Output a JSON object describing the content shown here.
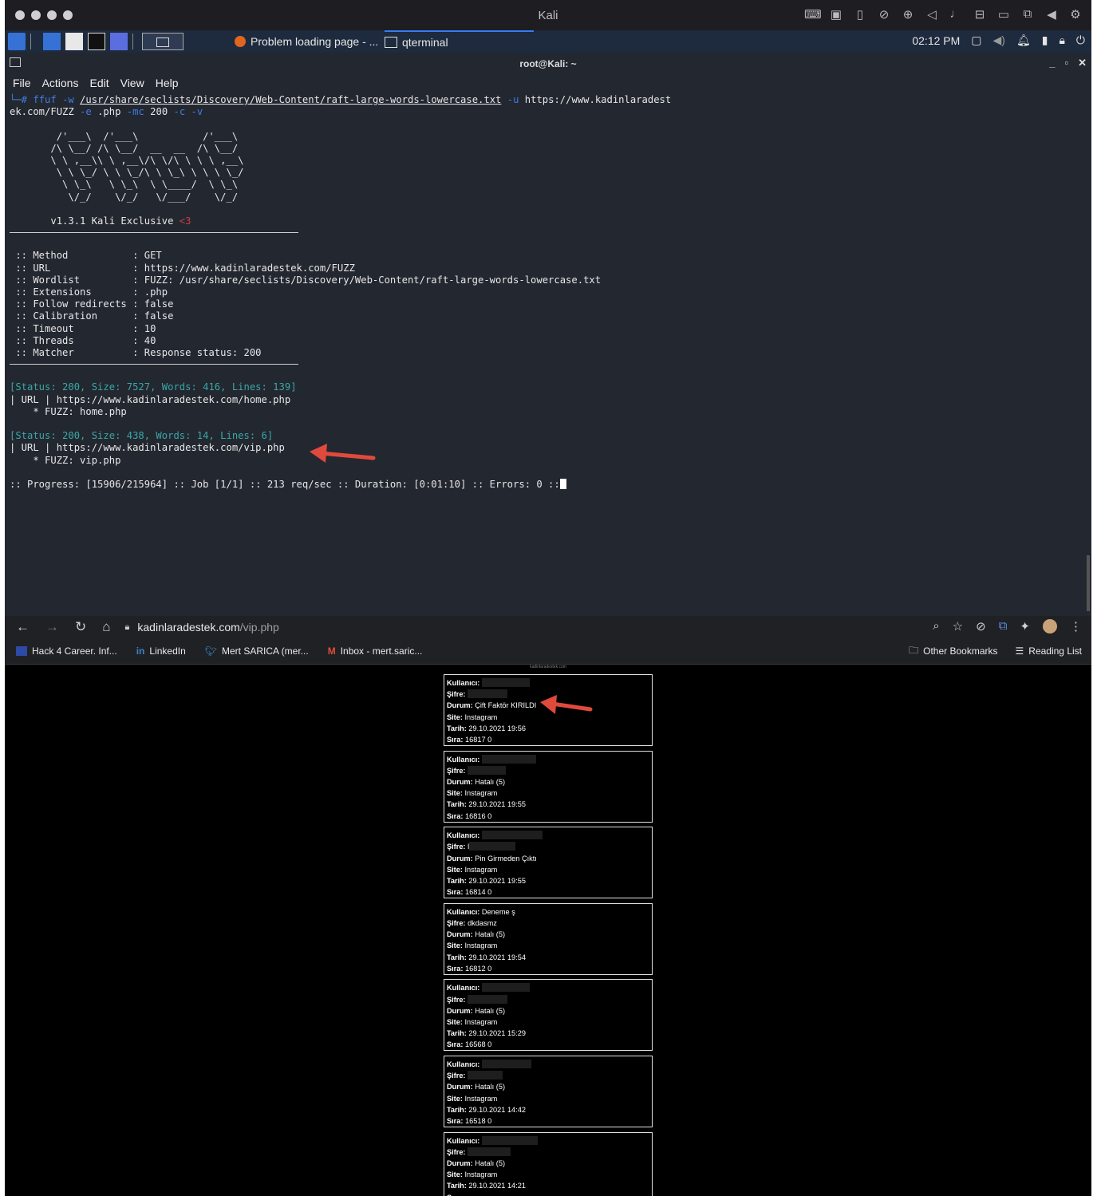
{
  "mac": {
    "title": "Kali"
  },
  "panel": {
    "tasks": [
      {
        "label": "Problem loading page - ..."
      },
      {
        "label": "qterminal"
      }
    ],
    "clock": "02:12 PM"
  },
  "terminal": {
    "window_title": "root@Kali: ~",
    "menu": [
      "File",
      "Actions",
      "Edit",
      "View",
      "Help"
    ],
    "command": {
      "prompt": "└─#",
      "cmd": "ffuf",
      "flag_w": "-w",
      "wordlist": "/usr/share/seclists/Discovery/Web-Content/raft-large-words-lowercase.txt",
      "flag_u": "-u",
      "url_part1": "https://www.kadinlaradest",
      "url_part2": "ek.com/FUZZ",
      "flag_e": "-e",
      "ext": ".php",
      "flag_mc": "-mc",
      "mc": "200",
      "flag_c": "-c",
      "flag_v": "-v"
    },
    "ascii_art": [
      "        /'___\\  /'___\\           /'___\\       ",
      "       /\\ \\__/ /\\ \\__/  __  __  /\\ \\__/       ",
      "       \\ \\ ,__\\\\ \\ ,__\\/\\ \\/\\ \\ \\ \\ ,__\\      ",
      "        \\ \\ \\_/ \\ \\ \\_/\\ \\ \\_\\ \\ \\ \\ \\_/      ",
      "         \\ \\_\\   \\ \\_\\  \\ \\____/  \\ \\_\\       ",
      "          \\/_/    \\/_/   \\/___/    \\/_/       "
    ],
    "version": "       v1.3.1 Kali Exclusive ",
    "heart": "<3",
    "config": [
      " :: Method           : GET",
      " :: URL              : https://www.kadinlaradestek.com/FUZZ",
      " :: Wordlist         : FUZZ: /usr/share/seclists/Discovery/Web-Content/raft-large-words-lowercase.txt",
      " :: Extensions       : .php",
      " :: Follow redirects : false",
      " :: Calibration      : false",
      " :: Timeout          : 10",
      " :: Threads          : 40",
      " :: Matcher          : Response status: 200"
    ],
    "results": [
      {
        "status": "[Status: 200, Size: 7527, Words: 416, Lines: 139]",
        "url": "| URL | https://www.kadinlaradestek.com/home.php",
        "fuzz": "    * FUZZ: home.php"
      },
      {
        "status": "[Status: 200, Size: 438, Words: 14, Lines: 6]",
        "url": "| URL | https://www.kadinlaradestek.com/vip.php",
        "fuzz": "    * FUZZ: vip.php"
      }
    ],
    "progress": ":: Progress: [15906/215964] :: Job [1/1] :: 213 req/sec :: Duration: [0:01:10] :: Errors: 0 ::"
  },
  "browser": {
    "url_host": "kadinlaradestek.com",
    "url_path": "/vip.php",
    "bookmarks": [
      "Hack 4 Career. Inf...",
      "LinkedIn",
      "Mert SARICA (mer...",
      "Inbox - mert.saric..."
    ],
    "bookmarks_right": [
      "Other Bookmarks",
      "Reading List"
    ],
    "tiny_header": "kadinlaradestek.com",
    "labels": {
      "user": "Kullanıcı:",
      "pass": "Şifre:",
      "status": "Durum:",
      "site": "Site:",
      "date": "Tarih:",
      "seq": "Sıra:"
    },
    "records": [
      {
        "user": "",
        "pass": "",
        "status": "Çift Faktör KIRILDI",
        "site": "Instagram",
        "date": "29.10.2021 19:56",
        "seq": "16817 0"
      },
      {
        "user": "",
        "pass": "",
        "status": "Hatalı (5)",
        "site": "Instagram",
        "date": "29.10.2021 19:55",
        "seq": "16816 0"
      },
      {
        "user": "",
        "pass": "l",
        "status": "Pin Girmeden Çıktı",
        "site": "Instagram",
        "date": "29.10.2021 19:55",
        "seq": "16814 0"
      },
      {
        "user": "Deneme ş",
        "pass": "dkdasmz",
        "status": "Hatalı (5)",
        "site": "Instagram",
        "date": "29.10.2021 19:54",
        "seq": "16812 0"
      },
      {
        "user": "",
        "pass": "",
        "status": "Hatalı (5)",
        "site": "Instagram",
        "date": "29.10.2021 15:29",
        "seq": "16568 0"
      },
      {
        "user": "",
        "pass": "",
        "status": "Hatalı (5)",
        "site": "Instagram",
        "date": "29.10.2021 14:42",
        "seq": "16518 0"
      },
      {
        "user": "",
        "pass": "",
        "status": "Hatalı (5)",
        "site": "Instagram",
        "date": "29.10.2021 14:21",
        "seq": ""
      }
    ]
  },
  "colors": {
    "accent_arrow": "#e04a3c",
    "terminal_bg": "#232730",
    "panel_bg": "#1e2a3d",
    "flag_blue": "#3d7fe3",
    "status_cyan": "#3aa7a7"
  }
}
